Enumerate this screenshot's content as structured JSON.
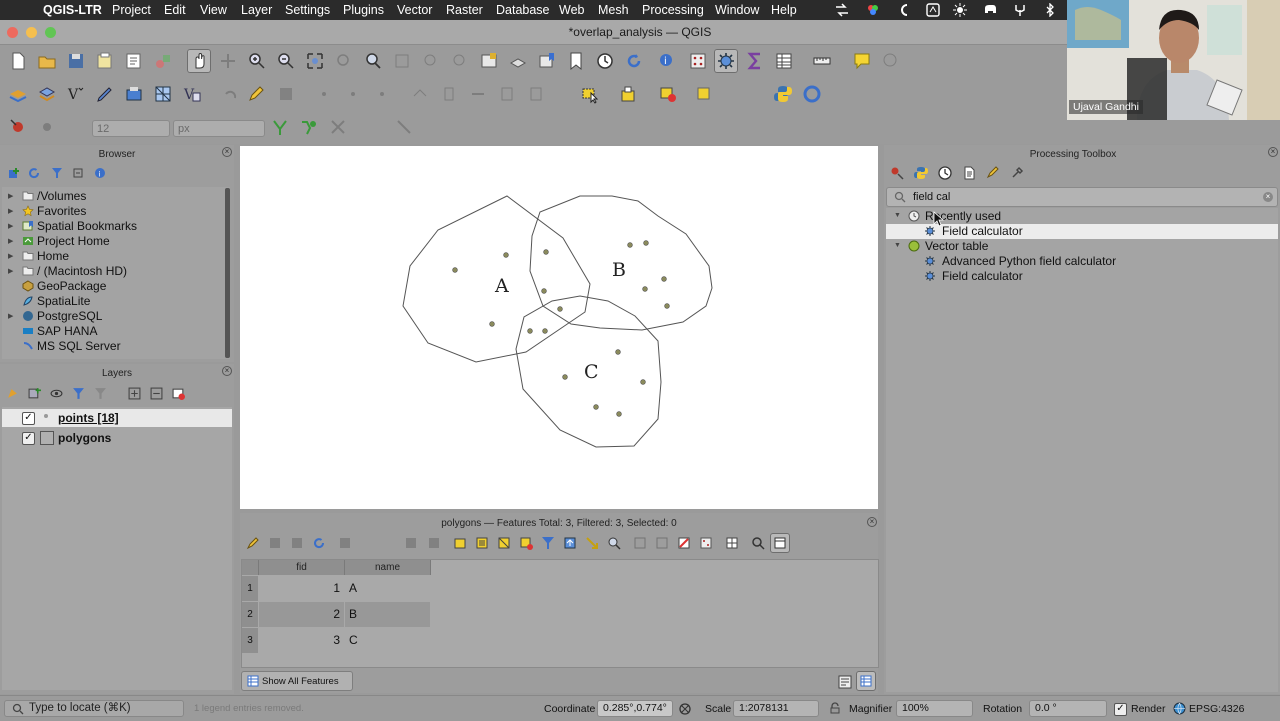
{
  "menubar": {
    "app_name": "QGIS-LTR",
    "items": [
      "Project",
      "Edit",
      "View",
      "Layer",
      "Settings",
      "Plugins",
      "Vector",
      "Raster",
      "Database",
      "Web",
      "Mesh",
      "Processing",
      "Window",
      "Help"
    ]
  },
  "window": {
    "title": "*overlap_analysis — QGIS"
  },
  "toolbar": {
    "font_size_value": "12",
    "font_unit_value": "px"
  },
  "browser": {
    "title": "Browser",
    "items": [
      {
        "label": "/Volumes",
        "icon": "folder-icon"
      },
      {
        "label": "Favorites",
        "icon": "star-icon"
      },
      {
        "label": "Spatial Bookmarks",
        "icon": "bookmark-icon"
      },
      {
        "label": "Project Home",
        "icon": "project-home-icon"
      },
      {
        "label": "Home",
        "icon": "folder-icon"
      },
      {
        "label": "/ (Macintosh HD)",
        "icon": "folder-icon"
      },
      {
        "label": "GeoPackage",
        "icon": "geopackage-icon"
      },
      {
        "label": "SpatiaLite",
        "icon": "spatialite-icon"
      },
      {
        "label": "PostgreSQL",
        "icon": "postgresql-icon"
      },
      {
        "label": "SAP HANA",
        "icon": "sap-hana-icon"
      },
      {
        "label": "MS SQL Server",
        "icon": "mssql-icon"
      }
    ]
  },
  "layers": {
    "title": "Layers",
    "items": [
      {
        "label": "points [18]",
        "checked": true
      },
      {
        "label": "polygons",
        "checked": true
      }
    ]
  },
  "map": {
    "polygon_labels": [
      "A",
      "B",
      "C"
    ],
    "colors": {
      "outline": "#555555",
      "point": "#8a8a5c"
    }
  },
  "attribute_table": {
    "title": "polygons — Features Total: 3, Filtered: 3, Selected: 0",
    "columns": [
      "fid",
      "name"
    ],
    "rows": [
      {
        "num": "1",
        "fid": "1",
        "name": "A"
      },
      {
        "num": "2",
        "fid": "2",
        "name": "B"
      },
      {
        "num": "3",
        "fid": "3",
        "name": "C"
      }
    ],
    "show_all_label": "Show All Features"
  },
  "processing": {
    "title": "Processing Toolbox",
    "search_value": "field cal",
    "groups": [
      {
        "label": "Recently used",
        "items": [
          "Field calculator"
        ]
      },
      {
        "label": "Vector table",
        "items": [
          "Advanced Python field calculator",
          "Field calculator"
        ]
      }
    ]
  },
  "status": {
    "locate_placeholder": "Type to locate (⌘K)",
    "legend_msg": "1 legend entries removed.",
    "coordinate_label": "Coordinate",
    "coordinate_value": "0.285°,0.774°",
    "scale_label": "Scale",
    "scale_value": "1:2078131",
    "magnifier_label": "Magnifier",
    "magnifier_value": "100%",
    "rotation_label": "Rotation",
    "rotation_value": "0.0 °",
    "render_label": "Render",
    "crs": "EPSG:4326"
  },
  "webcam": {
    "name": "Ujaval Gandhi"
  }
}
